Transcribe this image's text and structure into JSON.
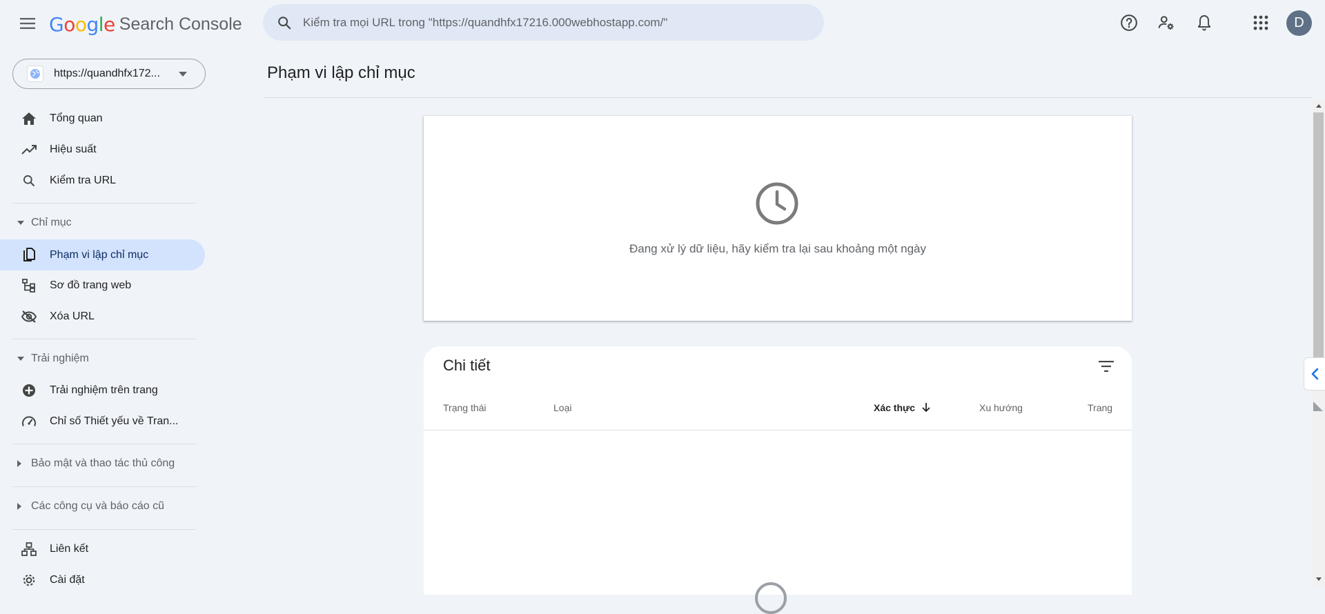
{
  "header": {
    "menu_icon": "hamburger-menu-icon",
    "logo_letters": [
      {
        "ch": "G",
        "color": "#4285F4"
      },
      {
        "ch": "o",
        "color": "#EA4335"
      },
      {
        "ch": "o",
        "color": "#FBBC05"
      },
      {
        "ch": "g",
        "color": "#4285F4"
      },
      {
        "ch": "l",
        "color": "#34A853"
      },
      {
        "ch": "e",
        "color": "#EA4335"
      }
    ],
    "product_name": "Search Console",
    "search_placeholder": "Kiểm tra mọi URL trong \"https://quandhfx17216.000webhostapp.com/\"",
    "icons": [
      "help-icon",
      "manage-users-icon",
      "notifications-icon",
      "apps-grid-icon"
    ],
    "avatar_initial": "D"
  },
  "property_selector": {
    "label": "https://quandhfx172...",
    "icon": "globe-icon"
  },
  "sidebar": {
    "top_items": [
      {
        "label": "Tổng quan",
        "icon": "home-icon"
      },
      {
        "label": "Hiệu suất",
        "icon": "trending-up-icon"
      },
      {
        "label": "Kiểm tra URL",
        "icon": "search-icon"
      }
    ],
    "index_section": {
      "label": "Chỉ mục",
      "expanded": true,
      "items": [
        {
          "label": "Phạm vi lập chỉ mục",
          "icon": "file-copy-icon",
          "active": true
        },
        {
          "label": "Sơ đồ trang web",
          "icon": "sitemap-icon"
        },
        {
          "label": "Xóa URL",
          "icon": "visibility-off-icon"
        }
      ]
    },
    "experience_section": {
      "label": "Trải nghiệm",
      "expanded": true,
      "items": [
        {
          "label": "Trải nghiệm trên trang",
          "icon": "page-experience-icon"
        },
        {
          "label": "Chỉ số Thiết yếu về Tran...",
          "icon": "speed-gauge-icon"
        }
      ]
    },
    "security_section": {
      "label": "Bảo mật và thao tác thủ công",
      "expanded": false
    },
    "legacy_section": {
      "label": "Các công cụ và báo cáo cũ",
      "expanded": false
    },
    "bottom_items": [
      {
        "label": "Liên kết",
        "icon": "links-icon"
      },
      {
        "label": "Cài đặt",
        "icon": "settings-icon"
      }
    ]
  },
  "main": {
    "page_title": "Phạm vi lập chỉ mục",
    "processing_card": {
      "icon": "clock-icon",
      "message": "Đang xử lý dữ liệu, hãy kiểm tra lại sau khoảng một ngày"
    },
    "details_card": {
      "title": "Chi tiết",
      "filter_icon": "filter-icon",
      "columns": [
        "Trạng thái",
        "Loại",
        "Xác thực",
        "Xu hướng",
        "Trang"
      ],
      "sorted_column": "Xác thực",
      "sort_direction": "descending"
    }
  },
  "colors": {
    "background": "#f0f4f9",
    "active_nav": "#d3e3fd",
    "search_bg": "#e1e8f5"
  }
}
